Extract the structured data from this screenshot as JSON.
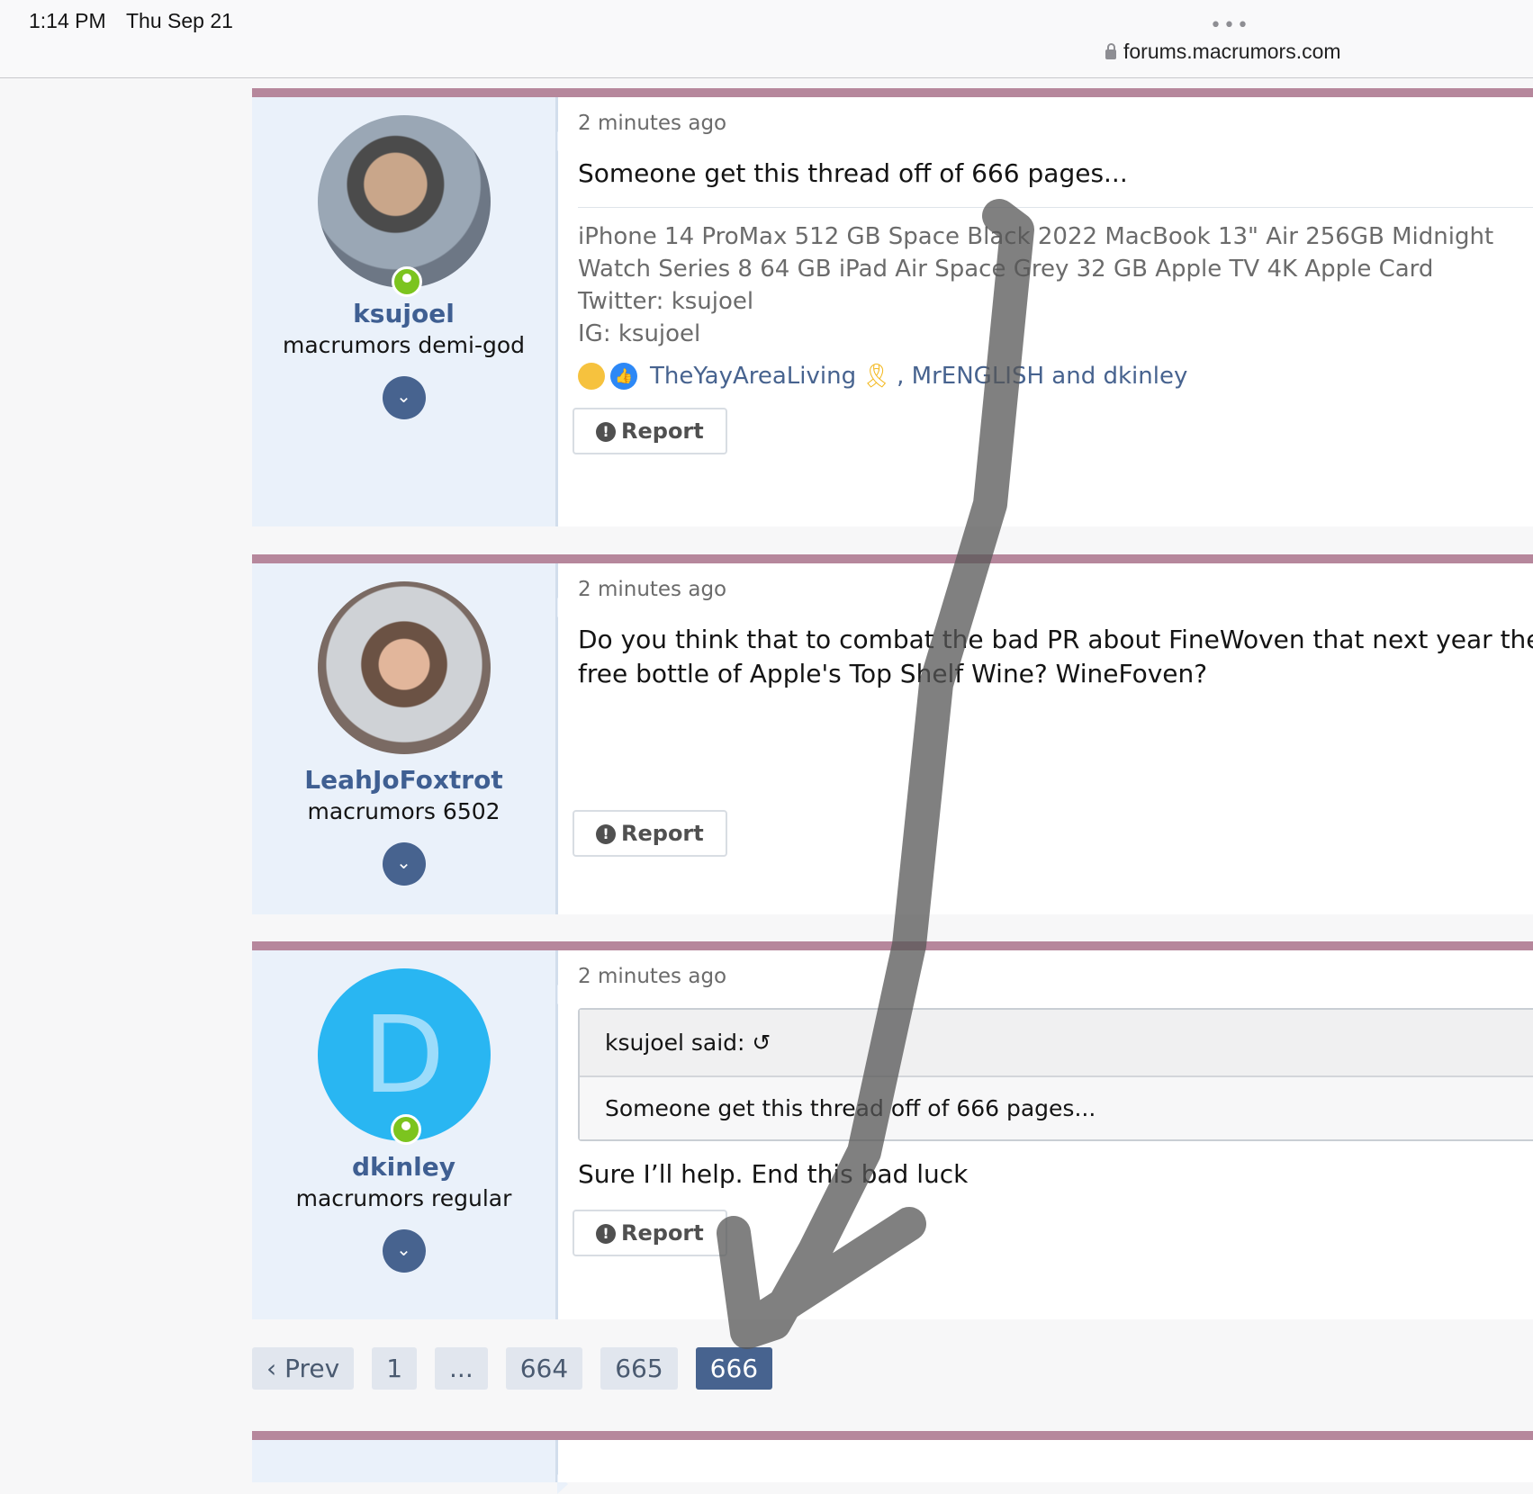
{
  "status": {
    "time": "1:14 PM",
    "date": "Thu Sep 21",
    "dots": "•••",
    "url": "forums.macrumors.com"
  },
  "posts": [
    {
      "username": "ksujoel",
      "title": "macrumors demi-god",
      "time": "2 minutes ago",
      "text": "Someone get this thread off of 666 pages...",
      "sig_line1": "iPhone 14 ProMax 512 GB Space Black  2022 MacBook 13\" Air 256GB Midnight",
      "sig_line2": "Watch Series 8  64 GB iPad Air Space Grey  32 GB Apple TV 4K  Apple Card",
      "sig_line3": "Twitter: ksujoel",
      "sig_line4": "IG: ksujoel",
      "reactors_1": "TheYayAreaLiving",
      "reactors_2": ", MrENGLISH and dkinley",
      "report": "Report"
    },
    {
      "username": "LeahJoFoxtrot",
      "title": "macrumors 6502",
      "time": "2 minutes ago",
      "text_line1": "Do you think that to combat the bad PR about FineWoven that next year they",
      "text_line2": "free bottle of Apple's Top Shelf Wine? WineFoven?",
      "report": "Report"
    },
    {
      "username": "dkinley",
      "title": "macrumors regular",
      "time": "2 minutes ago",
      "avatar_letter": "D",
      "quote_author": "ksujoel said:",
      "quote_text": "Someone get this thread off of 666 pages...",
      "text": "Sure I’ll help. End this bad luck",
      "report": "Report"
    }
  ],
  "pager": {
    "prev": "Prev",
    "p1": "1",
    "ellipsis": "...",
    "p664": "664",
    "p665": "665",
    "p666": "666"
  },
  "colors": {
    "post_bar": "#b6879c",
    "user_cell": "#eaf1fa",
    "username": "#3f5f92",
    "active_page": "#47638f",
    "online": "#7cc41f"
  },
  "icons": [
    "lock-icon",
    "apple-icon",
    "laugh-reaction-icon",
    "like-reaction-icon",
    "ribbon-icon",
    "exclamation-icon",
    "chevron-down-icon",
    "reply-arrow-icon",
    "chevron-left-icon"
  ]
}
